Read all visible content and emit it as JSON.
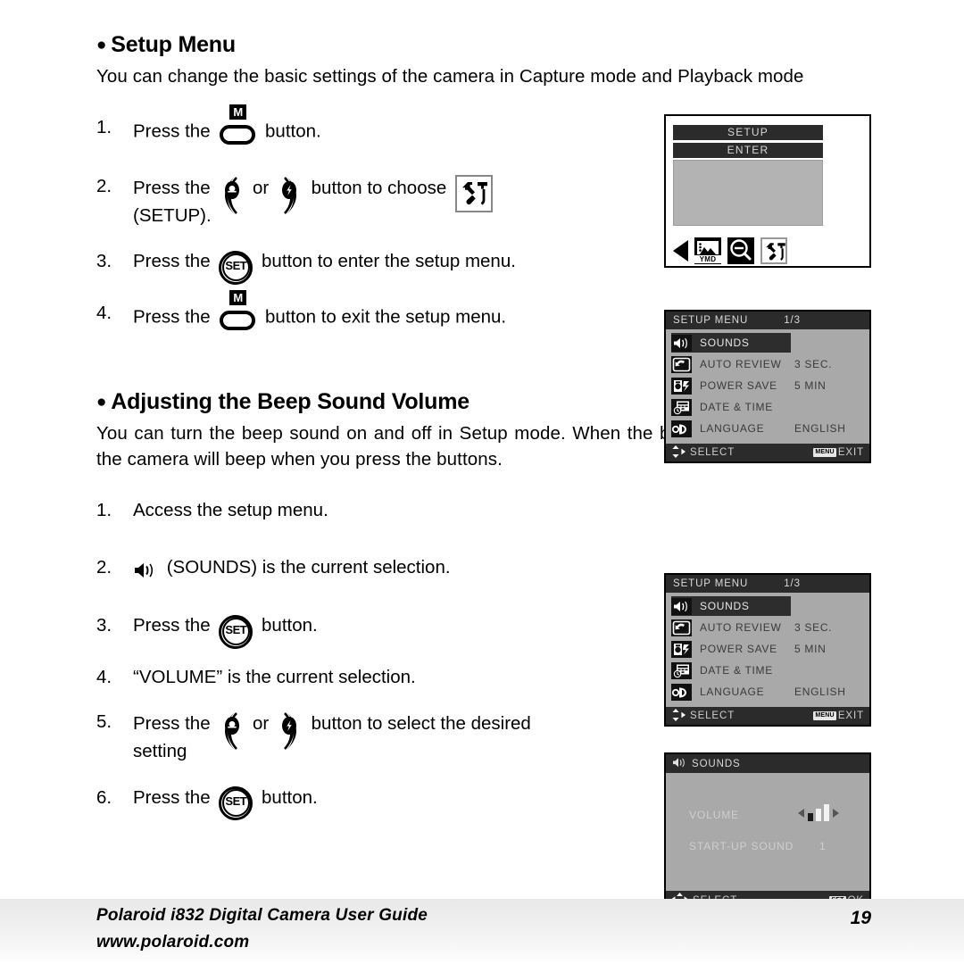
{
  "sections": [
    {
      "heading": "Setup Menu",
      "intro": "You can change the basic settings of the camera in Capture mode and Playback mode",
      "steps": [
        {
          "num": "1.",
          "pre": "Press the",
          "post": "button."
        },
        {
          "num": "2.",
          "pre": "Press the",
          "mid": "or",
          "post": "button to choose",
          "cont": "(SETUP)."
        },
        {
          "num": "3.",
          "pre": "Press the",
          "post": "button to enter the setup menu."
        },
        {
          "num": "4.",
          "pre": "Press the",
          "post": "button to exit the setup menu."
        }
      ]
    },
    {
      "heading": "Adjusting the Beep Sound Volume",
      "intro": "You can turn the beep sound on and off in Setup mode. When the beep sound is turned on, the camera will beep when you press the buttons.",
      "steps": [
        {
          "num": "1.",
          "text": "Access the setup menu."
        },
        {
          "num": "2.",
          "post": "(SOUNDS) is the current selection."
        },
        {
          "num": "3.",
          "pre": "Press the",
          "post": "button."
        },
        {
          "num": "4.",
          "text": "“VOLUME” is the current selection."
        },
        {
          "num": "5.",
          "pre": "Press the",
          "mid": "or",
          "post": "button to select the desired",
          "cont": "setting"
        },
        {
          "num": "6.",
          "pre": "Press the",
          "post": "button."
        }
      ]
    }
  ],
  "lcd_setup_enter": {
    "title": "SETUP",
    "enter": "ENTER",
    "icons": [
      "left-arrow",
      "ymd-picture-icon",
      "zoom-out-icon",
      "wrench-setup-icon"
    ],
    "ymd_label": "YMD",
    "selected_icon": "wrench-setup-icon"
  },
  "lcd_setup_menu": {
    "title": "SETUP MENU",
    "page": "1/3",
    "rows": [
      {
        "icon": "speaker-icon",
        "label": "SOUNDS",
        "value": "",
        "selected": true
      },
      {
        "icon": "auto-review-icon",
        "label": "AUTO REVIEW",
        "value": "3 SEC.",
        "selected": false
      },
      {
        "icon": "power-save-icon",
        "label": "POWER SAVE",
        "value": "5 MIN",
        "selected": false
      },
      {
        "icon": "date-time-icon",
        "label": "DATE & TIME",
        "value": "",
        "selected": false
      },
      {
        "icon": "language-icon",
        "label": "LANGUAGE",
        "value": "ENGLISH",
        "selected": false
      }
    ],
    "footer_select": "SELECT",
    "footer_exit_badge": "MENU",
    "footer_exit": "EXIT"
  },
  "lcd_sounds": {
    "title": "SOUNDS",
    "volume_label": "VOLUME",
    "volume_bars": 3,
    "volume_level": 1,
    "startup_label": "START-UP SOUND",
    "startup_value": "1",
    "footer_select": "SELECT",
    "footer_ok_badge": "SET",
    "footer_ok": "OK"
  },
  "footer": {
    "title": "Polaroid i832 Digital Camera User Guide",
    "url": "www.polaroid.com",
    "page_number": "19"
  },
  "colors": {
    "lcd_background": "#a9a9a9",
    "lcd_bar": "#2b2b2b",
    "lcd_text": "#d9d9d9",
    "lcd_dark_text": "#3a3a3a",
    "page_background": "#ffffff"
  }
}
